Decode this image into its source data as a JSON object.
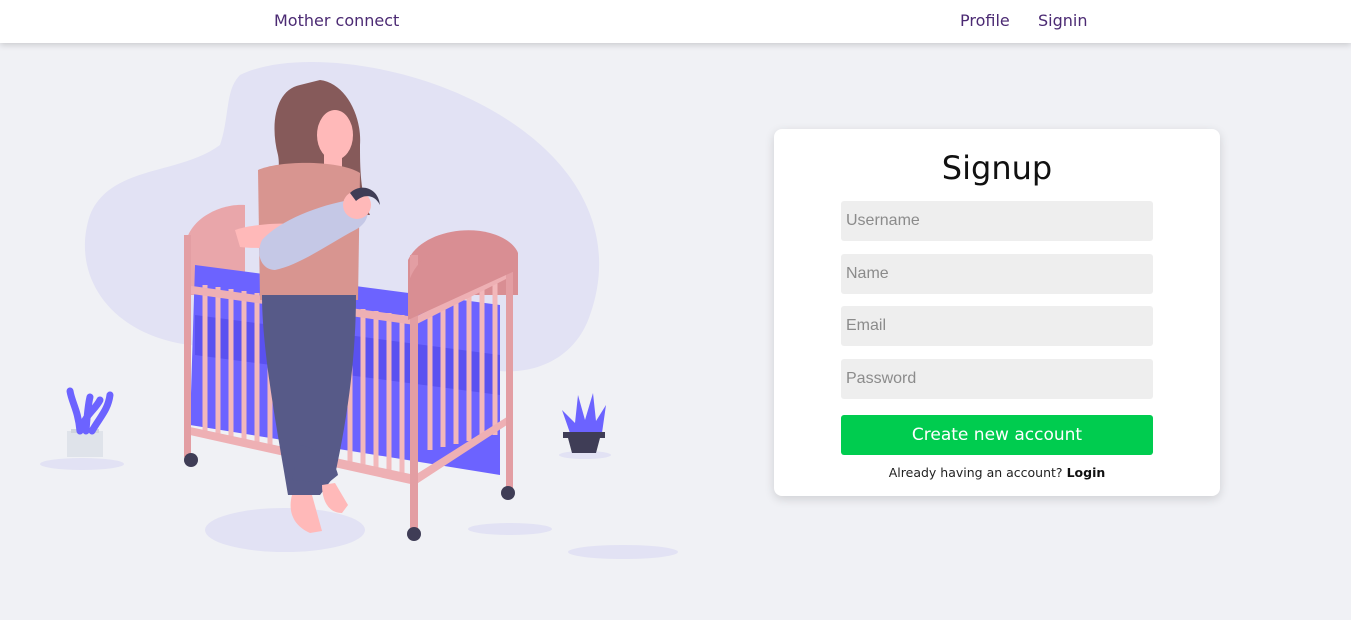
{
  "navbar": {
    "brand": "Mother connect",
    "links": [
      {
        "label": "Profile"
      },
      {
        "label": "Signin"
      }
    ]
  },
  "signup": {
    "title": "Signup",
    "fields": {
      "username_placeholder": "Username",
      "name_placeholder": "Name",
      "email_placeholder": "Email",
      "password_placeholder": "Password"
    },
    "submit_label": "Create new account",
    "login_prompt": "Already having an account?",
    "login_link": "Login"
  },
  "colors": {
    "brand_text": "#4b2a73",
    "submit_button": "#00cc4f",
    "page_background": "#f0f1f5",
    "field_background": "#eeeeee"
  }
}
